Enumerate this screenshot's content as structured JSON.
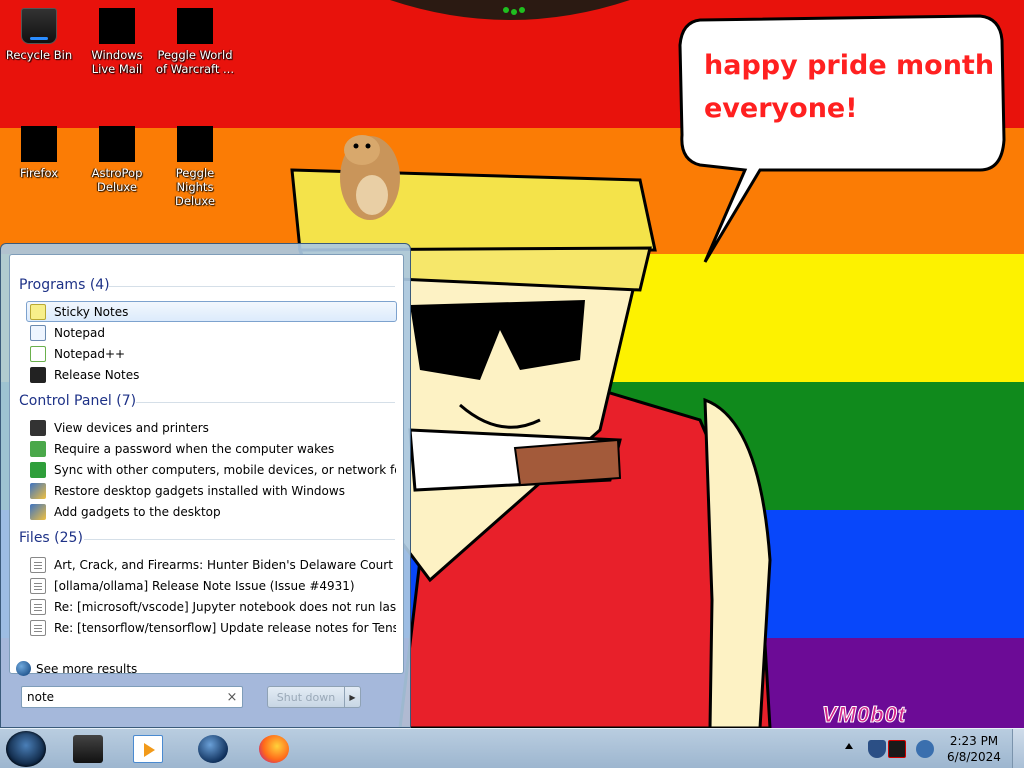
{
  "desktop": {
    "icons": [
      {
        "label": "Recycle Bin"
      },
      {
        "label": "Windows Live Mail"
      },
      {
        "label": "Peggle World of Warcraft ..."
      },
      {
        "label": "Firefox"
      },
      {
        "label": "AstroPop Deluxe"
      },
      {
        "label": "Peggle Nights Deluxe"
      }
    ],
    "speech_bubble": "happy pride month everyone!",
    "watermark": "VM0b0t",
    "stripe_colors": [
      "#e8120c",
      "#fb7c05",
      "#fdf200",
      "#108a1c",
      "#0847fa",
      "#6c0b96"
    ]
  },
  "start_menu": {
    "categories": {
      "programs": "Programs (4)",
      "control_panel": "Control Panel (7)",
      "files": "Files (25)"
    },
    "programs": [
      {
        "label": "Sticky Notes",
        "icon": "sticky-notes-icon"
      },
      {
        "label": "Notepad",
        "icon": "notepad-icon"
      },
      {
        "label": "Notepad++",
        "icon": "notepadpp-icon"
      },
      {
        "label": "Release Notes",
        "icon": "release-notes-icon"
      }
    ],
    "control_panel": [
      {
        "label": "View devices and printers"
      },
      {
        "label": "Require a password when the computer wakes"
      },
      {
        "label": "Sync with other computers, mobile devices, or network folders"
      },
      {
        "label": "Restore desktop gadgets installed with Windows"
      },
      {
        "label": "Add gadgets to the desktop"
      }
    ],
    "files": [
      {
        "label": "Art, Crack, and Firearms: Hunter Biden's Delaware Court Drama..."
      },
      {
        "label": "[ollama/ollama] Release Note Issue (Issue #4931)"
      },
      {
        "label": "Re: [microsoft/vscode] Jupyter notebook does not run last cell ..."
      },
      {
        "label": "Re: [tensorflow/tensorflow] Update release notes for TensorFlo..."
      }
    ],
    "see_more": "See more results",
    "search": {
      "value": "note",
      "clear": "×"
    },
    "shutdown_label": "Shut down",
    "accent": "#1e3287"
  },
  "taskbar": {
    "clock_time": "2:23 PM",
    "clock_date": "6/8/2024"
  }
}
